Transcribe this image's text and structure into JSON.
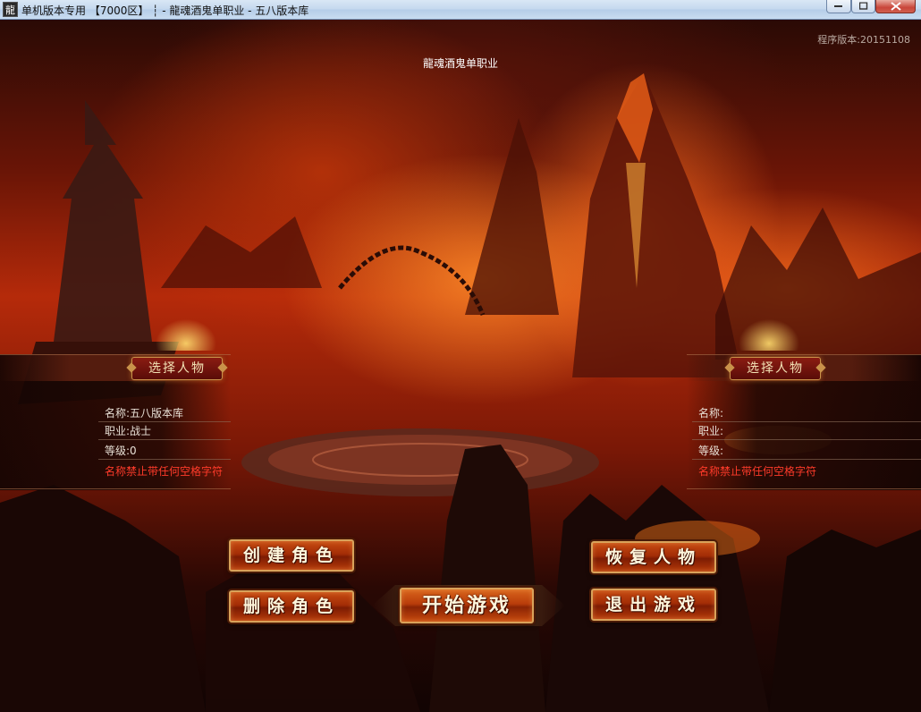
{
  "window": {
    "app_icon_glyph": "龍",
    "title": "单机版本专用 【7000区】 ┆ - 龍魂酒鬼单职业 - 五八版本库"
  },
  "header": {
    "version": "程序版本:20151108",
    "subtitle": "龍魂酒鬼单职业"
  },
  "left_panel": {
    "header": "选择人物",
    "name_label": "名称:",
    "name_value": "五八版本库",
    "job_label": "职业:",
    "job_value": "战士",
    "level_label": "等级:",
    "level_value": "0",
    "warning": "名称禁止带任何空格字符"
  },
  "right_panel": {
    "header": "选择人物",
    "name_label": "名称:",
    "name_value": "",
    "job_label": "职业:",
    "job_value": "",
    "level_label": "等级:",
    "level_value": "",
    "warning": "名称禁止带任何空格字符"
  },
  "buttons": {
    "create": "创建角色",
    "delete": "删除角色",
    "start": "开始游戏",
    "restore": "恢复人物",
    "exit": "退出游戏"
  },
  "colors": {
    "warning": "#ff3b2a",
    "button_border": "#d9a25a",
    "button_fill": "#a32d06"
  }
}
